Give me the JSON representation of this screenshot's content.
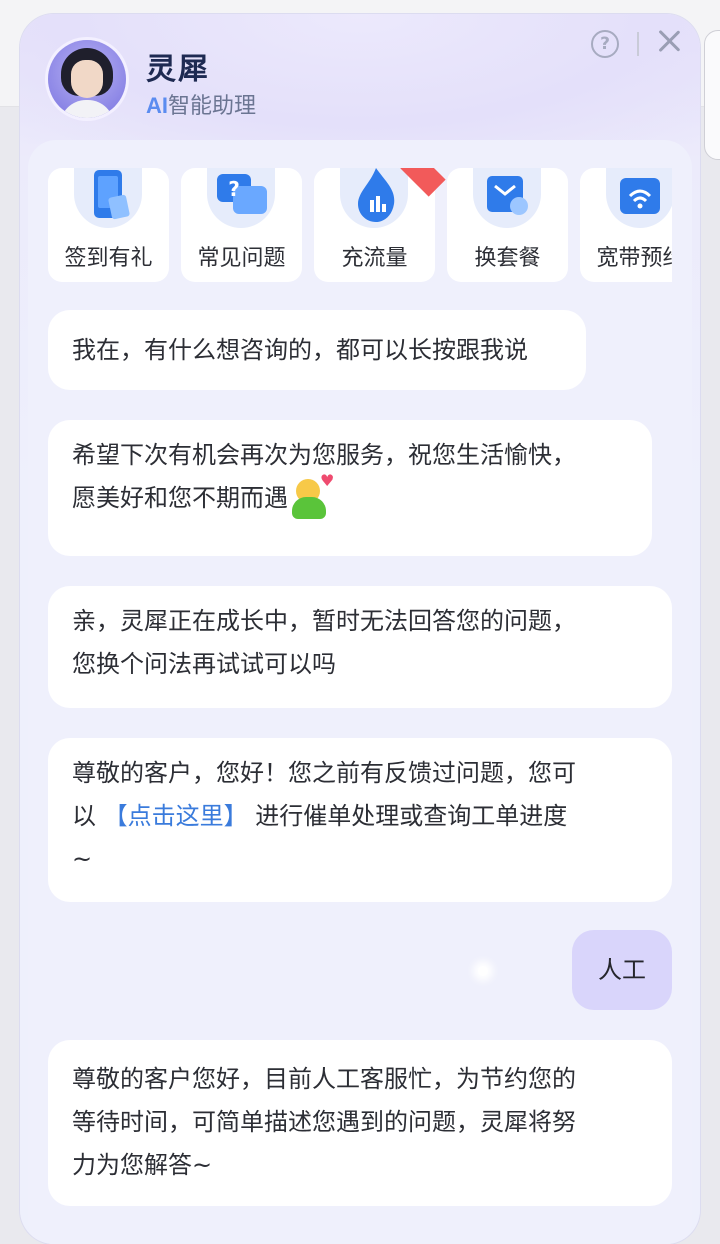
{
  "header": {
    "title": "灵犀",
    "subtitle_ai": "AI",
    "subtitle_text": "智能助理"
  },
  "quick_actions": [
    {
      "label": "签到有礼",
      "icon": "phone-gift-icon"
    },
    {
      "label": "常见问题",
      "icon": "question-chat-icon"
    },
    {
      "label": "充流量",
      "icon": "data-flame-icon"
    },
    {
      "label": "换套餐",
      "icon": "package-swap-icon"
    },
    {
      "label": "宽带预约",
      "icon": "broadband-wifi-icon"
    }
  ],
  "messages": {
    "m1": "我在，有什么想咨询的，都可以长按跟我说",
    "m2_line1": "希望下次有机会再次为您服务，祝您生活愉快，",
    "m2_line2": "愿美好和您不期而遇",
    "m3_line1": "亲，灵犀正在成长中，暂时无法回答您的问题，",
    "m3_line2": "您换个问法再试试可以吗",
    "m4_line1": "尊敬的客户，您好！您之前有反馈过问题，您可",
    "m4_prefix": "以 ",
    "m4_link": "【点击这里】",
    "m4_suffix": " 进行催单处理或查询工单进度",
    "m4_line3": "~",
    "user_msg": "人工",
    "m5_line1": "尊敬的客户您好，目前人工客服忙，为节约您的",
    "m5_line2": "等待时间，可简单描述您遇到的问题，灵犀将努",
    "m5_line3": "力为您解答~"
  },
  "colors": {
    "accent_link": "#3a7bdc",
    "user_bubble": "#d9d5fb",
    "title": "#1e2a52"
  }
}
